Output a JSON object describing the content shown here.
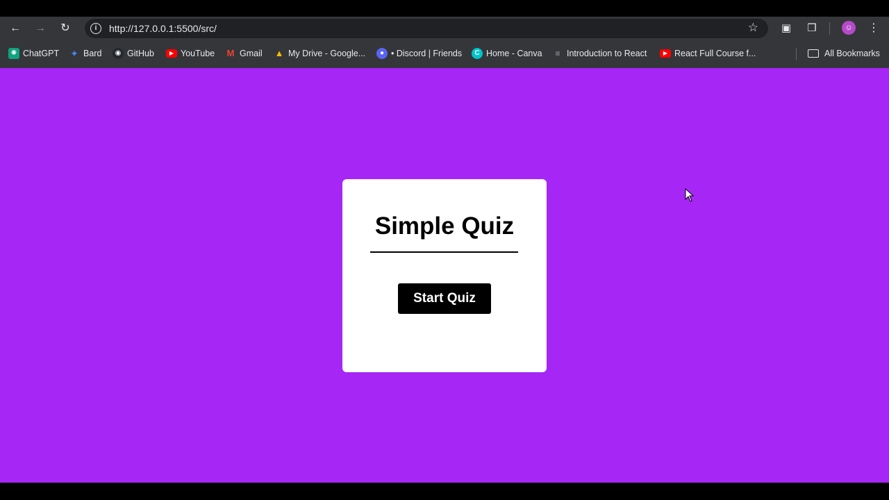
{
  "browser": {
    "url": "http://127.0.0.1:5500/src/",
    "bookmarks": [
      {
        "label": "ChatGPT",
        "icon": "chatgpt-icon",
        "color": "#10a37f"
      },
      {
        "label": "Bard",
        "icon": "bard-icon",
        "color": "#4285f4"
      },
      {
        "label": "GitHub",
        "icon": "github-icon",
        "color": "#24292e"
      },
      {
        "label": "YouTube",
        "icon": "youtube-icon",
        "color": "#ff0000"
      },
      {
        "label": "Gmail",
        "icon": "gmail-icon",
        "color": "#ea4335"
      },
      {
        "label": "My Drive - Google...",
        "icon": "drive-icon",
        "color": "#fbbc04"
      },
      {
        "label": "• Discord | Friends",
        "icon": "discord-icon",
        "color": "#5865f2"
      },
      {
        "label": "Home - Canva",
        "icon": "canva-icon",
        "color": "#00c4cc"
      },
      {
        "label": "Introduction to React",
        "icon": "react-icon",
        "color": "#9aa0a6"
      },
      {
        "label": "React Full Course f...",
        "icon": "youtube-icon",
        "color": "#ff0000"
      }
    ],
    "all_bookmarks_label": "All Bookmarks"
  },
  "quiz": {
    "title": "Simple Quiz",
    "start_label": "Start Quiz"
  },
  "colors": {
    "page_background": "#a626f5",
    "card_background": "#ffffff",
    "button_background": "#000000"
  }
}
